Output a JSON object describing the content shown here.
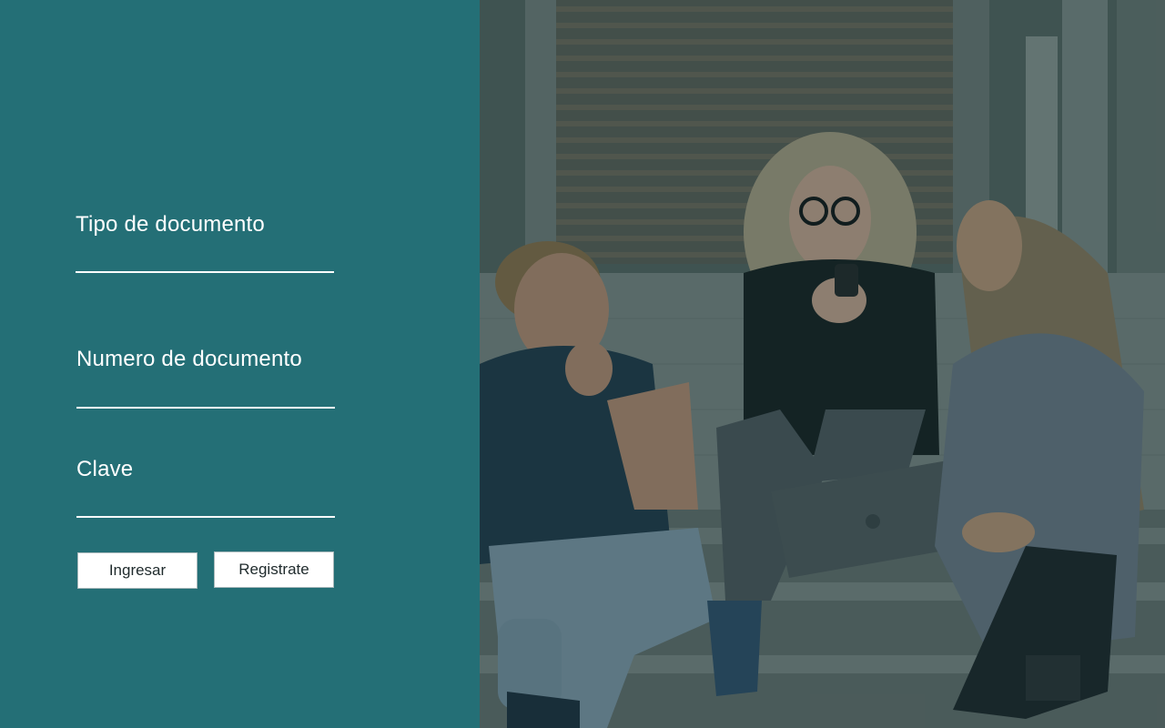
{
  "form": {
    "tipo_documento_label": "Tipo de documento",
    "numero_documento_label": "Numero de documento",
    "clave_label": "Clave",
    "tipo_documento_value": "",
    "numero_documento_value": "",
    "clave_value": ""
  },
  "buttons": {
    "ingresar_label": "Ingresar",
    "registrate_label": "Registrate"
  },
  "colors": {
    "panel_background": "#246f76",
    "text": "#ffffff",
    "button_background": "#ffffff"
  },
  "photo": {
    "subject": "three-students-sitting-on-steps-with-laptop"
  }
}
